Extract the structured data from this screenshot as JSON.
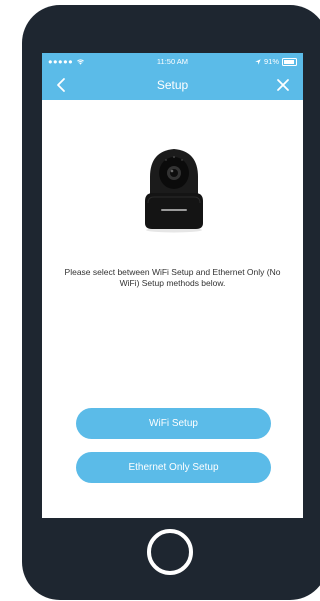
{
  "status_bar": {
    "signal": "●●●●● ",
    "time": "11:50 AM",
    "battery": "91%"
  },
  "nav": {
    "title": "Setup",
    "back_icon": "chevron-left-icon",
    "close_icon": "close-icon"
  },
  "content": {
    "product_image": "security-camera",
    "instructions": "Please select between WiFi Setup and Ethernet Only (No WiFi) Setup methods below."
  },
  "buttons": {
    "wifi_setup": "WiFi Setup",
    "ethernet_setup": "Ethernet Only Setup"
  },
  "colors": {
    "accent": "#5bbbe8",
    "phone_body": "#1e2630"
  }
}
